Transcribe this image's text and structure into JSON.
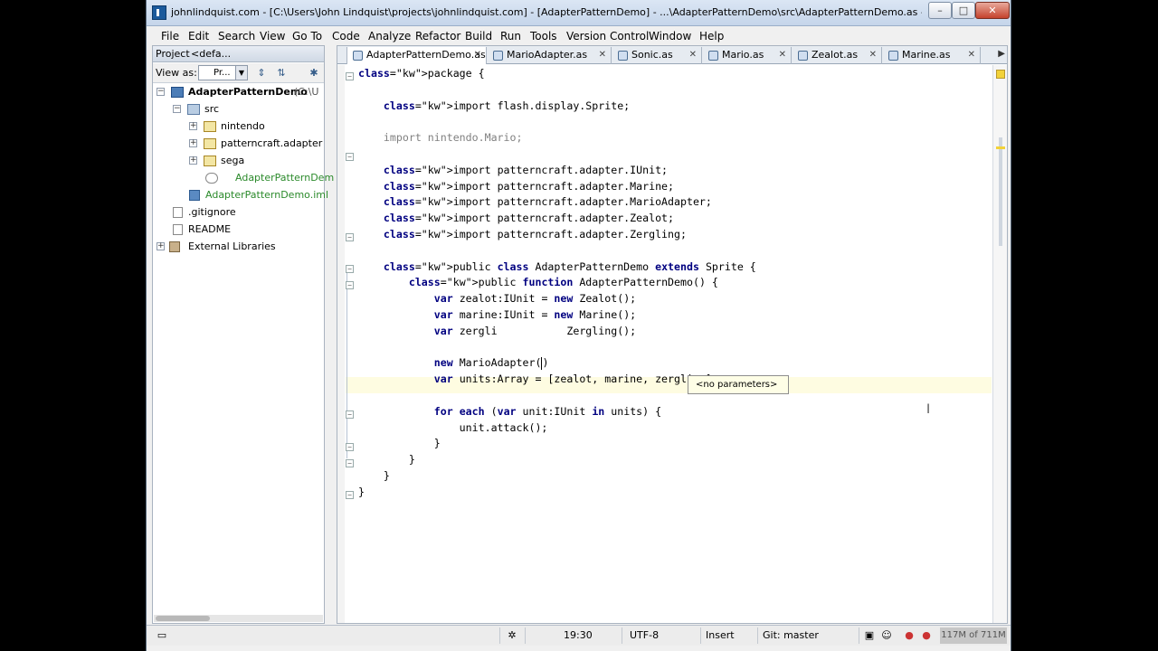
{
  "window": {
    "title": "johnlindquist.com - [C:\\Users\\John Lindquist\\projects\\johnlindquist.com] - [AdapterPatternDemo] - ...\\AdapterPatternDemo\\src\\AdapterPatternDemo.as - IntelliJ IDE..."
  },
  "menu": [
    "File",
    "Edit",
    "Search",
    "View",
    "Go To",
    "Code",
    "Analyze",
    "Refactor",
    "Build",
    "Run",
    "Tools",
    "Version Control",
    "Window",
    "Help"
  ],
  "project": {
    "label": "Project",
    "scope": "<defa...",
    "view_as": "View as:",
    "dropdown": "Pr..."
  },
  "tree": [
    {
      "label": "AdapterPatternDemo",
      "suffix": "(C:\\U",
      "icon": "module-icon"
    },
    {
      "label": "src",
      "icon": "source-folder-icon"
    },
    {
      "label": "nintendo",
      "icon": "package-icon"
    },
    {
      "label": "patterncraft.adapter",
      "icon": "package-icon"
    },
    {
      "label": "sega",
      "icon": "package-icon"
    },
    {
      "label": "AdapterPatternDem",
      "icon": "actionscript-class-icon"
    },
    {
      "label": "AdapterPatternDemo.iml",
      "icon": "iml-file-icon"
    },
    {
      "label": ".gitignore",
      "icon": "text-file-icon"
    },
    {
      "label": "README",
      "icon": "text-file-icon"
    },
    {
      "label": "External Libraries",
      "icon": "library-icon"
    }
  ],
  "tabs": [
    {
      "label": "AdapterPatternDemo.as",
      "active": true
    },
    {
      "label": "MarioAdapter.as"
    },
    {
      "label": "Sonic.as"
    },
    {
      "label": "Mario.as"
    },
    {
      "label": "Zealot.as"
    },
    {
      "label": "Marine.as"
    }
  ],
  "code_lines": [
    "package {",
    "",
    "    import flash.display.Sprite;",
    "",
    "    import nintendo.Mario;",
    "",
    "    import patterncraft.adapter.IUnit;",
    "    import patterncraft.adapter.Marine;",
    "    import patterncraft.adapter.MarioAdapter;",
    "    import patterncraft.adapter.Zealot;",
    "    import patterncraft.adapter.Zergling;",
    "",
    "    public class AdapterPatternDemo extends Sprite {",
    "        public function AdapterPatternDemo() {",
    "            var zealot:IUnit = new Zealot();",
    "            var marine:IUnit = new Marine();",
    "            var zergli           Zergling();",
    "",
    "            new MarioAdapter()",
    "            var units:Array = [zealot, marine, zergling];",
    "",
    "            for each (var unit:IUnit in units) {",
    "                unit.attack();",
    "            }",
    "        }",
    "    }",
    "}"
  ],
  "tooltip": "<no parameters>",
  "status": {
    "position": "19:30",
    "encoding": "UTF-8",
    "mode": "Insert",
    "vcs": "Git: master",
    "memory": "117M of 711M"
  }
}
